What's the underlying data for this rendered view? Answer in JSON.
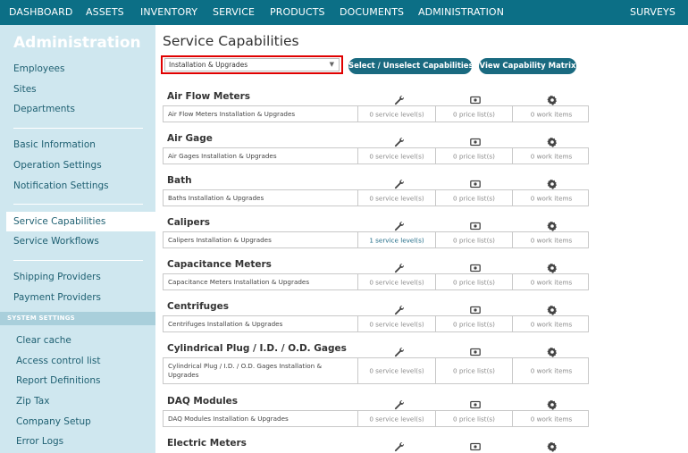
{
  "nav": {
    "items": [
      "DASHBOARD",
      "ASSETS",
      "INVENTORY",
      "SERVICE",
      "PRODUCTS",
      "DOCUMENTS",
      "ADMINISTRATION"
    ],
    "right_item": "SURVEYS"
  },
  "sidebar": {
    "title": "Administration",
    "group1": [
      "Employees",
      "Sites",
      "Departments"
    ],
    "group2": [
      "Basic Information",
      "Operation Settings",
      "Notification Settings"
    ],
    "group3": [
      "Service Capabilities",
      "Service Workflows"
    ],
    "group4": [
      "Shipping Providers",
      "Payment Providers"
    ],
    "section_label": "SYSTEM SETTINGS",
    "system": [
      "Clear cache",
      "Access control list",
      "Report Definitions",
      "Zip Tax",
      "Company Setup",
      "Error Logs"
    ],
    "active_item": "Service Capabilities"
  },
  "main": {
    "title": "Service Capabilities",
    "filter": {
      "selected": "Installation & Upgrades"
    },
    "buttons": {
      "select_unselect": "Select / Unselect Capabilities",
      "view_matrix": "View Capability Matrix"
    },
    "column_icons": [
      "wrench-icon",
      "money-icon",
      "gear-icon"
    ],
    "groups": [
      {
        "title": "Air Flow Meters",
        "row": {
          "name": "Air Flow Meters Installation & Upgrades",
          "service_levels": "0 service level(s)",
          "price_lists": "0 price list(s)",
          "work_items": "0 work items"
        }
      },
      {
        "title": "Air Gage",
        "row": {
          "name": "Air Gages Installation & Upgrades",
          "service_levels": "0 service level(s)",
          "price_lists": "0 price list(s)",
          "work_items": "0 work items"
        }
      },
      {
        "title": "Bath",
        "row": {
          "name": "Baths Installation & Upgrades",
          "service_levels": "0 service level(s)",
          "price_lists": "0 price list(s)",
          "work_items": "0 work items"
        }
      },
      {
        "title": "Calipers",
        "row": {
          "name": "Calipers Installation & Upgrades",
          "service_levels": "1 service level(s)",
          "price_lists": "0 price list(s)",
          "work_items": "0 work items"
        }
      },
      {
        "title": "Capacitance Meters",
        "row": {
          "name": "Capacitance Meters Installation & Upgrades",
          "service_levels": "0 service level(s)",
          "price_lists": "0 price list(s)",
          "work_items": "0 work items"
        }
      },
      {
        "title": "Centrifuges",
        "row": {
          "name": "Centrifuges Installation & Upgrades",
          "service_levels": "0 service level(s)",
          "price_lists": "0 price list(s)",
          "work_items": "0 work items"
        }
      },
      {
        "title": "Cylindrical Plug / I.D. / O.D. Gages",
        "row": {
          "name": "Cylindrical Plug / I.D. / O.D. Gages Installation & Upgrades",
          "service_levels": "0 service level(s)",
          "price_lists": "0 price list(s)",
          "work_items": "0 work items"
        }
      },
      {
        "title": "DAQ Modules",
        "row": {
          "name": "DAQ Modules Installation & Upgrades",
          "service_levels": "0 service level(s)",
          "price_lists": "0 price list(s)",
          "work_items": "0 work items"
        }
      },
      {
        "title": "Electric Meters"
      }
    ]
  },
  "colors": {
    "nav_bg": "#0c6f86",
    "sidebar_bg": "#cfe7ef",
    "button_bg": "#1a6a80",
    "highlight_border": "#e00000"
  }
}
